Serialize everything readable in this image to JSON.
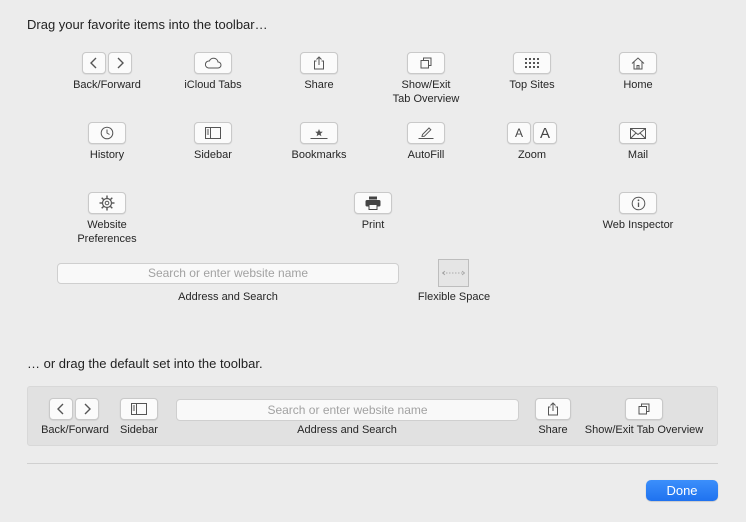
{
  "headings": {
    "favorites": "Drag your favorite items into the toolbar…",
    "default_set": "… or drag the default set into the toolbar."
  },
  "items": {
    "back_forward": "Back/Forward",
    "icloud_tabs": "iCloud Tabs",
    "share": "Share",
    "show_exit_tab_overview": "Show/Exit\nTab Overview",
    "top_sites": "Top Sites",
    "home": "Home",
    "history": "History",
    "sidebar": "Sidebar",
    "bookmarks": "Bookmarks",
    "autofill": "AutoFill",
    "zoom": "Zoom",
    "zoom_small_glyph": "A",
    "zoom_large_glyph": "A",
    "mail": "Mail",
    "website_preferences": "Website\nPreferences",
    "print": "Print",
    "web_inspector": "Web Inspector",
    "address_and_search": "Address and Search",
    "search_placeholder": "Search or enter website name",
    "flexible_space": "Flexible Space"
  },
  "default_set": {
    "back_forward": "Back/Forward",
    "sidebar": "Sidebar",
    "address_and_search": "Address and Search",
    "search_placeholder": "Search or enter website name",
    "share": "Share",
    "show_exit_tab_overview": "Show/Exit Tab Overview"
  },
  "done_label": "Done",
  "colors": {
    "done_button": "#1f72ef",
    "background": "#ececec"
  }
}
